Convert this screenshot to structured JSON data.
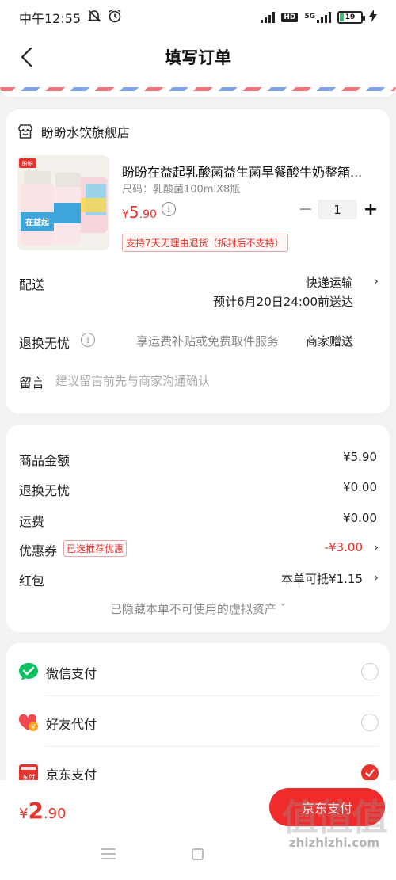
{
  "status_bar": {
    "time": "中午12:55",
    "network": "5G",
    "hd_label": "HD",
    "battery": "19",
    "battery_level": 0.19
  },
  "header": {
    "title": "填写订单"
  },
  "store": {
    "name": "盼盼水饮旗舰店"
  },
  "product": {
    "title": "盼盼在益起乳酸菌益生菌早餐酸牛奶整箱...",
    "spec": "尺码：乳酸菌100mlX8瓶",
    "price_symbol": "¥",
    "price_int": "5",
    "price_dec": ".90",
    "quantity": "1",
    "return_policy": "支持7天无理由退货（拆封后不支持）",
    "image_text": "在益起"
  },
  "delivery": {
    "label": "配送",
    "method": "快递运输",
    "eta": "预计6月20日24:00前送达"
  },
  "return_service": {
    "label": "退换无忧",
    "description": "享运费补贴或免费取件服务",
    "provider": "商家赠送"
  },
  "note": {
    "label": "留言",
    "placeholder": "建议留言前先与商家沟通确认"
  },
  "amounts": {
    "goods_label": "商品金额",
    "goods_value": "¥5.90",
    "return_label": "退换无忧",
    "return_value": "¥0.00",
    "shipping_label": "运费",
    "shipping_value": "¥0.00",
    "coupon_label": "优惠券",
    "coupon_badge": "已选推荐优惠",
    "coupon_value": "-¥3.00",
    "redpacket_label": "红包",
    "redpacket_value": "本单可抵¥1.15",
    "hidden_note": "已隐藏本单不可使用的虚拟资产 ˇ"
  },
  "payment": {
    "methods": [
      {
        "label": "微信支付",
        "icon": "wechat-pay-icon",
        "selected": false
      },
      {
        "label": "好友代付",
        "icon": "friend-pay-icon",
        "selected": false
      },
      {
        "label": "京东支付",
        "icon": "jd-pay-icon",
        "selected": true
      }
    ]
  },
  "footer": {
    "total_symbol": "¥",
    "total_int": "2",
    "total_dec": ".90",
    "submit_label": "京东支付",
    "watermark_logo": "值值值",
    "watermark_url": "zhizhizhi.com"
  },
  "colors": {
    "accent": "#e8322d",
    "wechat_green": "#07c160"
  }
}
